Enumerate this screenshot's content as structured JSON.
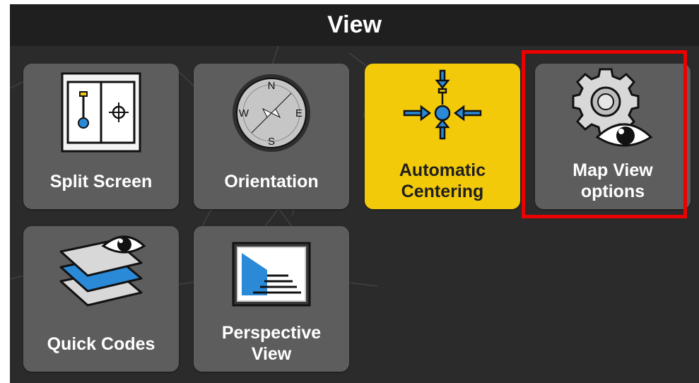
{
  "header": {
    "title": "View"
  },
  "tiles": {
    "split_screen": {
      "label": "Split Screen",
      "icon": "split-screen-icon"
    },
    "orientation": {
      "label": "Orientation",
      "icon": "compass-icon",
      "compass": {
        "n": "N",
        "s": "S",
        "e": "E",
        "w": "W"
      }
    },
    "automatic_centering": {
      "label_line1": "Automatic",
      "label_line2": "Centering",
      "icon": "centering-icon",
      "state": "active"
    },
    "map_view_options": {
      "label_line1": "Map View",
      "label_line2": "options",
      "icon": "gear-eye-icon",
      "highlighted": true
    },
    "quick_codes": {
      "label": "Quick Codes",
      "icon": "layers-eye-icon"
    },
    "perspective_view": {
      "label_line1": "Perspective",
      "label_line2": "View",
      "icon": "perspective-icon"
    }
  },
  "colors": {
    "tile_bg": "#5d5d5d",
    "active_bg": "#f2ca0a",
    "highlight_border": "#ec0000",
    "accent_blue": "#2a8ad8"
  }
}
